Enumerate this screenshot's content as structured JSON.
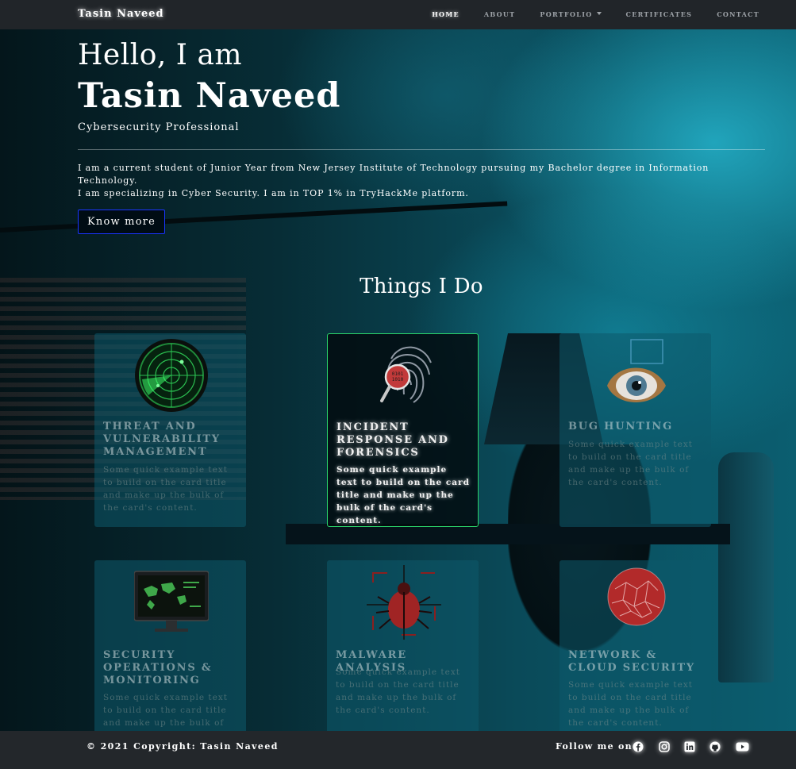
{
  "nav": {
    "brand": "Tasin Naveed",
    "links": [
      {
        "label": "HOME"
      },
      {
        "label": "ABOUT"
      },
      {
        "label": "PORTFOLIO"
      },
      {
        "label": "CERTIFICATES"
      },
      {
        "label": "CONTACT"
      }
    ]
  },
  "hero": {
    "greeting": "Hello, I am",
    "name": "Tasin Naveed",
    "subtitle": "Cybersecurity Professional",
    "bio_line1": "I am a current student of Junior Year from New Jersey Institute of Technology pursuing my Bachelor degree in Information Technology.",
    "bio_line2": "I am specializing in Cyber Security. I am in TOP 1% in TryHackMe platform.",
    "button": "Know more"
  },
  "services": {
    "title": "Things I Do",
    "cards": [
      {
        "title": "THREAT AND VULNERABILITY MANAGEMENT",
        "text": "Some quick example text to build on the card title and make up the bulk of the card's content.",
        "icon": "radar-icon"
      },
      {
        "title": "INCIDENT RESPONSE AND FORENSICS",
        "text": "Some quick example text to build on the card title and make up the bulk of the card's content.",
        "icon": "fingerprint-icon"
      },
      {
        "title": "BUG HUNTING",
        "text": "Some quick example text to build on the card title and make up the bulk of the card's content.",
        "icon": "eye-icon"
      },
      {
        "title": "SECURITY OPERATIONS & MONITORING",
        "text": "Some quick example text to build on the card title and make up the bulk of the card's content.",
        "icon": "monitor-map-icon"
      },
      {
        "title": "MALWARE ANALYSIS",
        "text": "Some quick example text to build on the card title and make up the bulk of the card's content.",
        "icon": "bug-icon"
      },
      {
        "title": "NETWORK & CLOUD SECURITY",
        "text": "Some quick example text to build on the card title and make up the bulk of the card's content.",
        "icon": "network-globe-icon"
      }
    ]
  },
  "footer": {
    "copyright": "© 2021 Copyright: Tasin Naveed",
    "follow": "Follow me on:",
    "social": [
      "facebook-icon",
      "instagram-icon",
      "linkedin-icon",
      "github-icon",
      "youtube-icon"
    ]
  },
  "colors": {
    "navbar": "#212529",
    "footer": "#23272b",
    "button_border": "#1a35ff",
    "highlight_border": "#2bd46a"
  }
}
